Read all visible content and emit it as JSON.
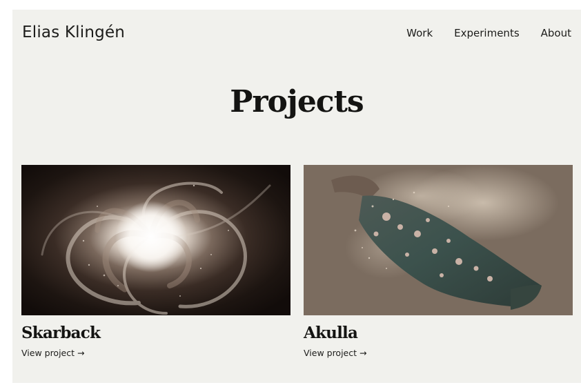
{
  "header": {
    "site_name": "Elias Klingén",
    "nav": [
      {
        "label": "Work"
      },
      {
        "label": "Experiments"
      },
      {
        "label": "About"
      }
    ]
  },
  "main": {
    "title": "Projects",
    "projects": [
      {
        "title": "Skarback",
        "link_label": "View project →",
        "image": "swirling-vortex-image"
      },
      {
        "title": "Akulla",
        "link_label": "View project →",
        "image": "disintegrating-stone-artifact-image"
      }
    ]
  },
  "colors": {
    "page_background": "#f1f1ed",
    "text": "#1a1a18",
    "akulla_background": "#7b6c5f"
  }
}
